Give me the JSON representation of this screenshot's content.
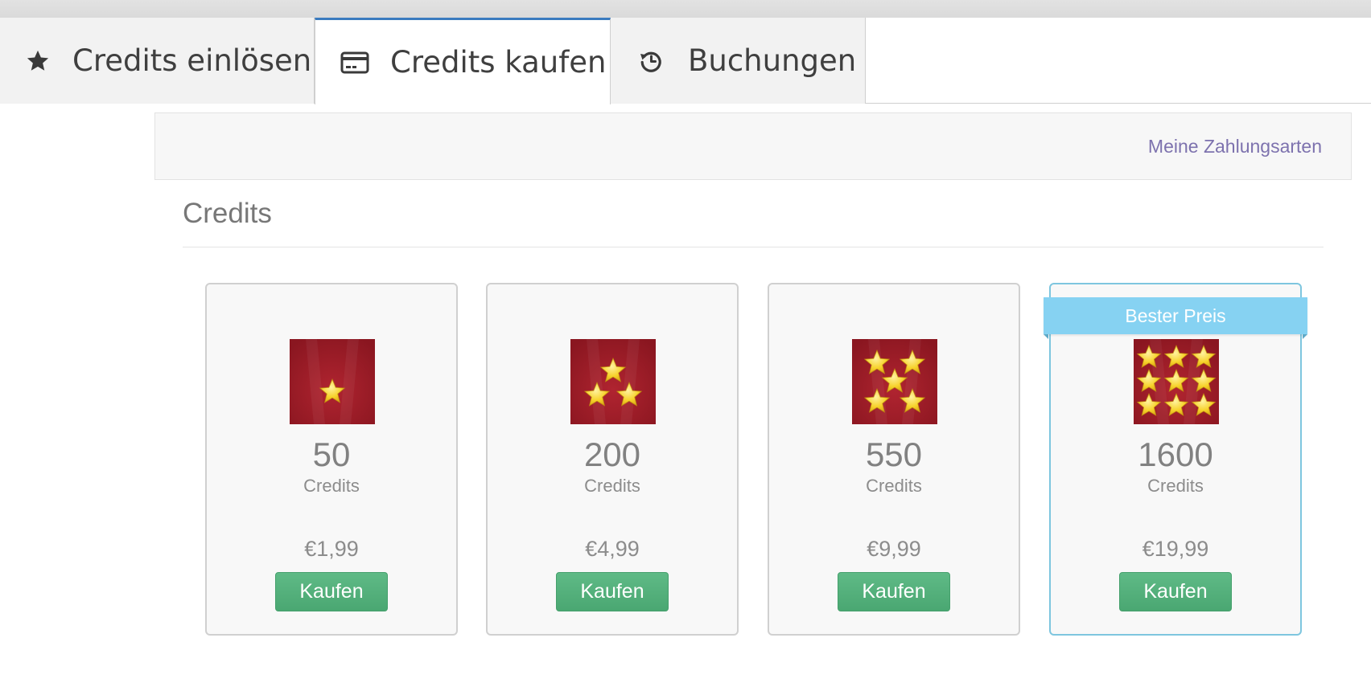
{
  "tabs": [
    {
      "label": "Credits einlösen",
      "icon": "star-icon",
      "active": false
    },
    {
      "label": "Credits kaufen",
      "icon": "credit-card-icon",
      "active": true
    },
    {
      "label": "Buchungen",
      "icon": "history-icon",
      "active": false
    }
  ],
  "payment_methods_link": "Meine Zahlungsarten",
  "section_title": "Credits",
  "packages": [
    {
      "amount": "50",
      "unit": "Credits",
      "price": "€1,99",
      "button": "Kaufen",
      "stars": 1
    },
    {
      "amount": "200",
      "unit": "Credits",
      "price": "€4,99",
      "button": "Kaufen",
      "stars": 3
    },
    {
      "amount": "550",
      "unit": "Credits",
      "price": "€9,99",
      "button": "Kaufen",
      "stars": 5
    },
    {
      "amount": "1600",
      "unit": "Credits",
      "price": "€19,99",
      "button": "Kaufen",
      "stars": 9,
      "badge": "Bester Preis"
    }
  ],
  "colors": {
    "active_tab_accent": "#3b7bbf",
    "buy_button": "#52ad79",
    "best_price_badge": "#86d2f2",
    "link": "#7d72ae",
    "thumbnail_background": "#8a1620",
    "star": "#f7d22a"
  }
}
